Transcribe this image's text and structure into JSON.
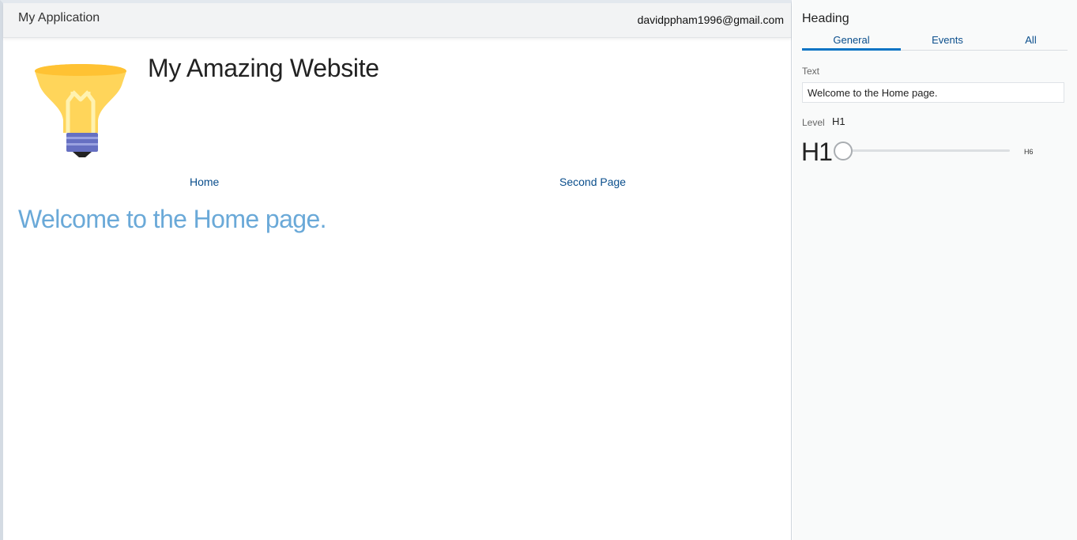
{
  "app": {
    "title": "My Application",
    "user_email": "davidppham1996@gmail.com"
  },
  "site": {
    "title": "My Amazing Website",
    "logo_icon": "lightbulb-icon",
    "nav": [
      {
        "label": "Home"
      },
      {
        "label": "Second Page"
      }
    ],
    "heading": "Welcome to the Home page."
  },
  "panel": {
    "title": "Heading",
    "tabs": [
      {
        "label": "General",
        "active": true
      },
      {
        "label": "Events",
        "active": false
      },
      {
        "label": "All",
        "active": false
      }
    ],
    "text_field": {
      "label": "Text",
      "value": "Welcome to the Home page."
    },
    "level": {
      "label": "Level",
      "value": "H1",
      "min_label": "H1",
      "max_label": "H6",
      "slider_fraction": 0
    }
  },
  "colors": {
    "accent": "#0a74c4",
    "link": "#0a4e8c",
    "heading_blue": "#6aa9d8",
    "bulb_yellow": "#ffd55a",
    "bulb_base": "#6670c2"
  }
}
